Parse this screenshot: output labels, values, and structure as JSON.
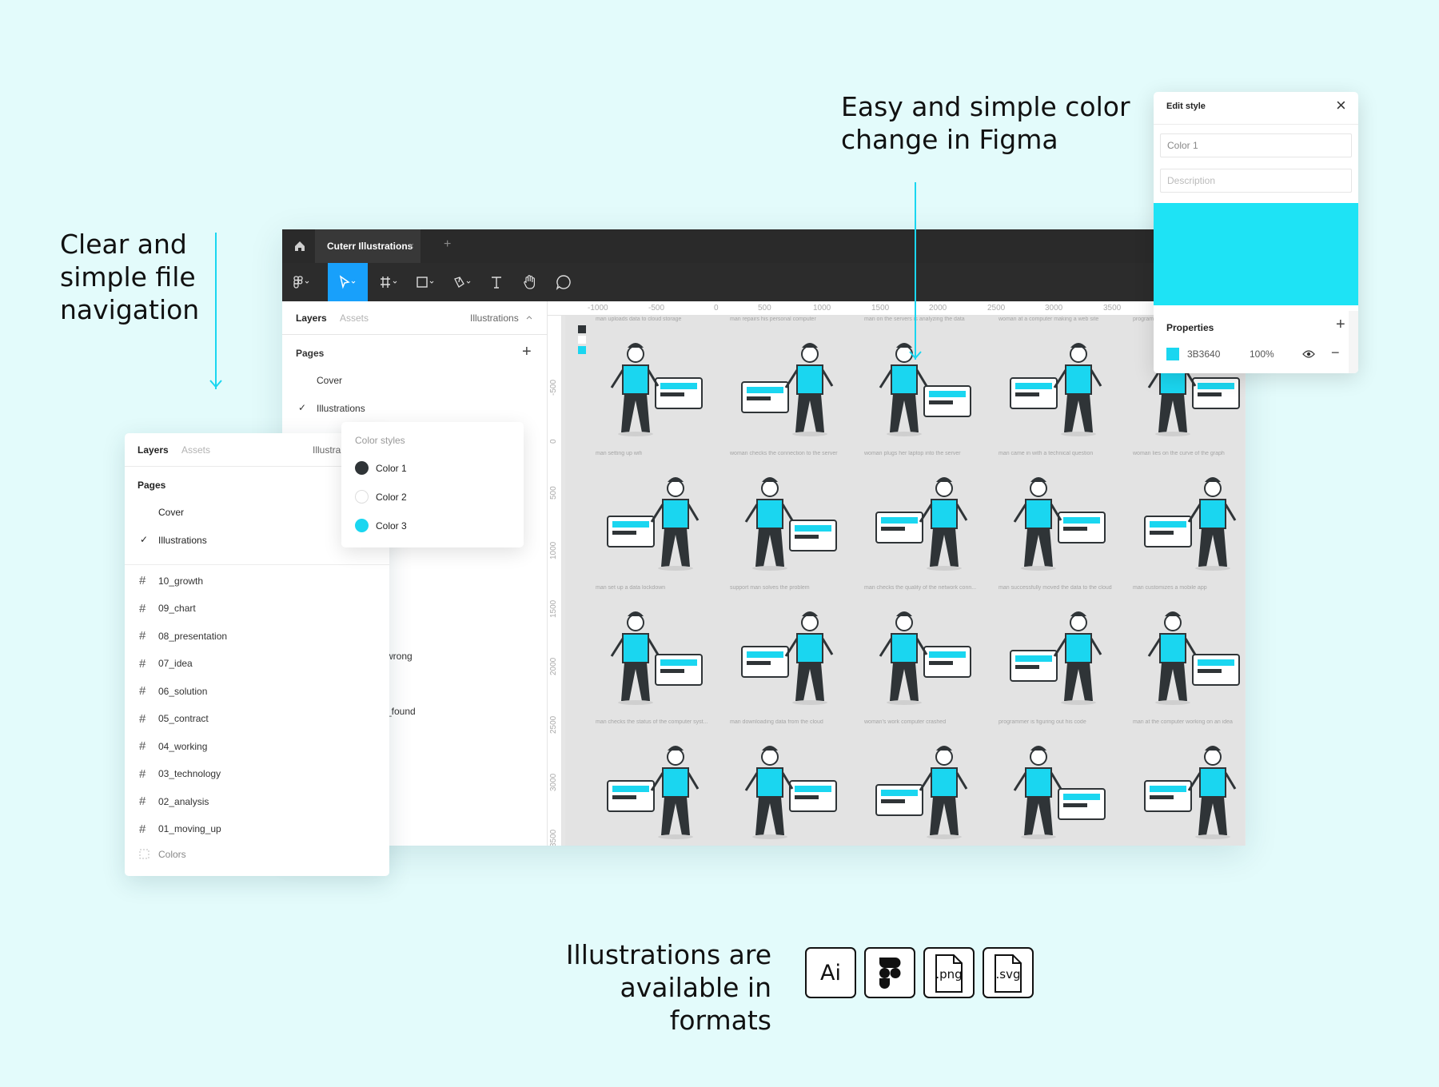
{
  "headings": {
    "navigation": [
      "Clear and",
      "simple file",
      "navigation"
    ],
    "color_change": [
      "Easy and simple color",
      "change in Figma"
    ],
    "formats": [
      "Illustrations are",
      "available in formats"
    ]
  },
  "formats": [
    ".png",
    ".svg"
  ],
  "formats_ai": "Ai",
  "figma": {
    "tab_title": "Cuterr Illustrations",
    "tab_close": "×",
    "tab_add": "+",
    "panel": {
      "tab_layers": "Layers",
      "tab_assets": "Assets",
      "current_page": "Illustrations",
      "pages_label": "Pages",
      "add_page": "+",
      "pages": [
        "Cover",
        "Illustrations"
      ],
      "checked": "✓",
      "partial_rows": [
        "wrong",
        "_found"
      ]
    },
    "ruler_top": [
      "-1000",
      "-500",
      "0",
      "500",
      "1000",
      "1500",
      "2000",
      "2500",
      "3000",
      "3500"
    ],
    "ruler_left": [
      "-500",
      "0",
      "500",
      "1000",
      "1500",
      "2000",
      "2500",
      "3000",
      "3500"
    ],
    "captions": [
      [
        "man uploads data to cloud storage",
        "man repairs his personal computer",
        "man on the servers is analyzing the data",
        "woman at a computer making a web site",
        "programmer"
      ],
      [
        "man setting up wifi",
        "woman checks the connection to the server",
        "woman plugs her laptop into the server",
        "man came in with a technical question",
        "woman lies on the curve of the graph"
      ],
      [
        "man set up a data lockdown",
        "support man solves the problem",
        "man checks the quality of the network conn...",
        "man successfully moved the data to the cloud",
        "man customizes a mobile app"
      ],
      [
        "man checks the status of the computer syst...",
        "man downloading data from the cloud",
        "woman's work computer crashed",
        "programmer is figuring out his code",
        "man at the computer working on an idea"
      ]
    ]
  },
  "layers_panel": {
    "tab_layers": "Layers",
    "tab_assets": "Assets",
    "current_page": "Illustra",
    "pages_label": "Pages",
    "pages": [
      "Cover",
      "Illustrations"
    ],
    "checked": "✓",
    "frames": [
      "10_growth",
      "09_chart",
      "08_presentation",
      "07_idea",
      "06_solution",
      "05_contract",
      "04_working",
      "03_technology",
      "02_analysis",
      "01_moving_up"
    ],
    "colors_item": "Colors",
    "hash": "#"
  },
  "color_styles": {
    "title": "Color styles",
    "items": [
      {
        "name": "Color 1",
        "color": "#2f3437"
      },
      {
        "name": "Color 2",
        "color": "#ffffff"
      },
      {
        "name": "Color 3",
        "color": "#1ad6f0"
      }
    ]
  },
  "edit_style": {
    "title": "Edit style",
    "close": "×",
    "name_value": "Color 1",
    "description_placeholder": "Description",
    "preview_color": "#1ee3f5",
    "properties_label": "Properties",
    "add": "+",
    "hex": "3B3640",
    "opacity": "100%",
    "remove": "−"
  },
  "colors": {
    "accent": "#1ad6f0",
    "dark": "#2f3437",
    "background": "#e3fbfb"
  }
}
